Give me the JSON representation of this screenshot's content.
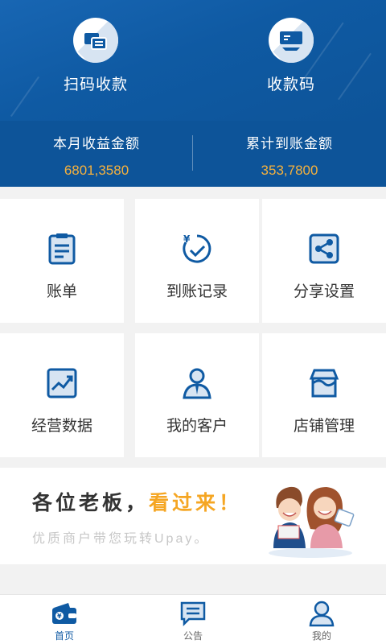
{
  "header": {
    "quick_actions": [
      {
        "label": "扫码收款",
        "icon": "scan-collect-icon"
      },
      {
        "label": "收款码",
        "icon": "payment-code-icon"
      }
    ],
    "stats": [
      {
        "title": "本月收益金额",
        "value": "6801,3580"
      },
      {
        "title": "累计到账金额",
        "value": "353,7800"
      }
    ]
  },
  "grid": [
    {
      "label": "账单",
      "icon": "bill-icon"
    },
    {
      "label": "到账记录",
      "icon": "arrival-record-icon"
    },
    {
      "label": "分享设置",
      "icon": "share-icon"
    },
    {
      "label": "经营数据",
      "icon": "chart-icon"
    },
    {
      "label": "我的客户",
      "icon": "customer-icon"
    },
    {
      "label": "店铺管理",
      "icon": "store-icon"
    }
  ],
  "banner": {
    "title_prefix": "各位老板，",
    "title_highlight": "看过来！",
    "subtitle": "优质商户带您玩转Upay。",
    "illustration": "couple-illustration"
  },
  "tabbar": [
    {
      "label": "首页",
      "icon": "wallet-icon",
      "active": true
    },
    {
      "label": "公告",
      "icon": "announcement-icon",
      "active": false
    },
    {
      "label": "我的",
      "icon": "user-icon",
      "active": false
    }
  ],
  "colors": {
    "primary": "#0f5aa3",
    "accent": "#f5b13d",
    "highlight": "#f5a623"
  }
}
